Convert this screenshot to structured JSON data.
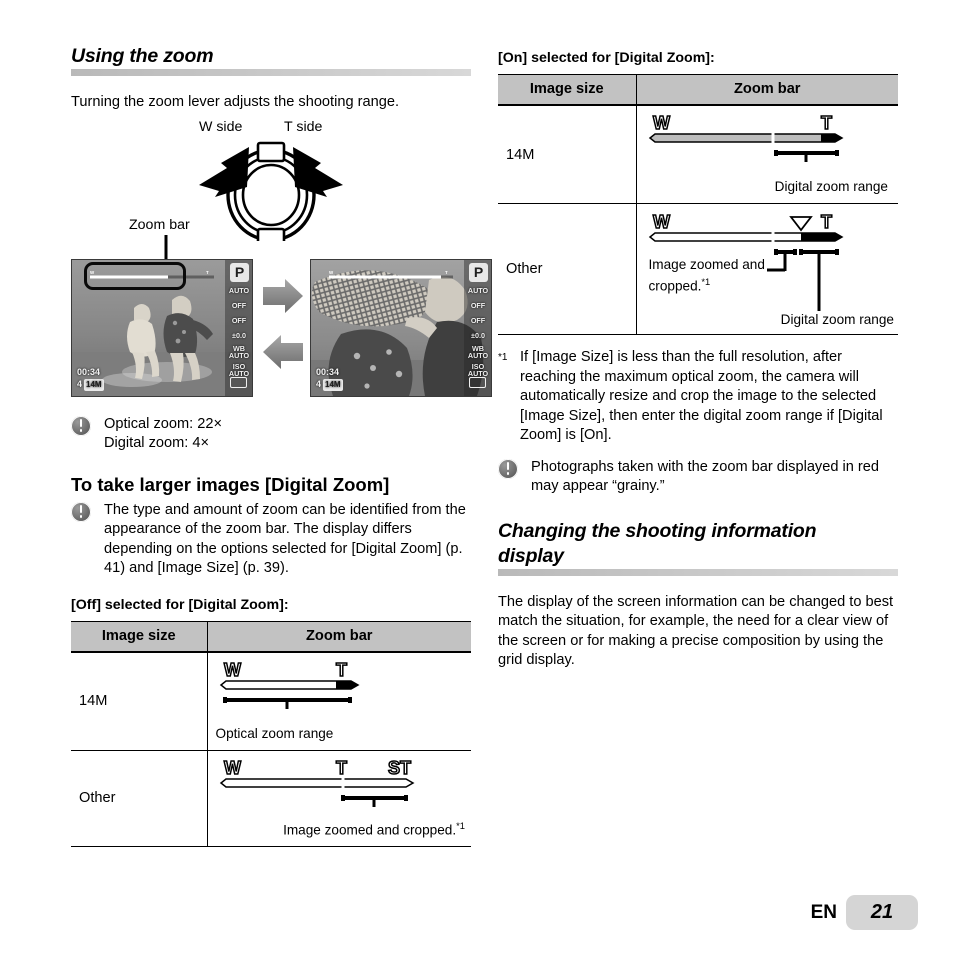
{
  "document": {
    "language_code": "EN",
    "page_number": "21"
  },
  "left_column": {
    "section_title": "Using the zoom",
    "intro": "Turning the zoom lever adjusts the shooting range.",
    "lever": {
      "w_label": "W side",
      "t_label": "T side"
    },
    "screens": {
      "callout": "Zoom bar",
      "osd": {
        "mode": "P",
        "flash": "AUTO",
        "macro": "OFF",
        "timer": "OFF",
        "exposure": "±0.0",
        "wb_label": "WB",
        "wb_value": "AUTO",
        "iso_label": "ISO",
        "iso_value": "AUTO",
        "record_time": "00:34",
        "shots_remaining": "4",
        "image_size": "14M",
        "bar_w": "W",
        "bar_t": "T"
      }
    },
    "zoom_note": {
      "optical": "Optical zoom: 22×",
      "digital": "Digital zoom: 4×"
    },
    "sub_heading": "To take larger images [Digital Zoom]",
    "sub_note": "The type and amount of zoom can be identified from the appearance of the zoom bar. The display differs depending on the options selected for [Digital Zoom] (p. 41) and [Image Size] (p. 39).",
    "table_caption": "[Off] selected for [Digital Zoom]:",
    "table": {
      "headers": [
        "Image size",
        "Zoom bar"
      ],
      "rows": [
        {
          "size": "14M",
          "markers": {
            "w": "W",
            "t": "T"
          },
          "caption": "Optical zoom range",
          "caption_sup": ""
        },
        {
          "size": "Other",
          "markers": {
            "w": "W",
            "t": "T",
            "st": "ST"
          },
          "caption": "Image zoomed and cropped.",
          "caption_sup": "*1"
        }
      ]
    }
  },
  "right_column": {
    "table_caption": "[On] selected for [Digital Zoom]:",
    "table": {
      "headers": [
        "Image size",
        "Zoom bar"
      ],
      "rows": [
        {
          "size": "14M",
          "markers": {
            "w": "W",
            "t": "T"
          },
          "caption": "Digital zoom range"
        },
        {
          "size": "Other",
          "markers": {
            "w": "W",
            "t": "T"
          },
          "caption_a": "Image zoomed and",
          "caption_a2": "cropped.",
          "caption_a_sup": "*1",
          "caption_b": "Digital zoom range"
        }
      ]
    },
    "footnote": {
      "mark": "*1",
      "text": "If [Image Size] is less than the full resolution, after reaching the maximum optical zoom, the camera will automatically resize and crop the image to the selected [Image Size], then enter the digital zoom range if [Digital Zoom] is [On]."
    },
    "grainy_note": "Photographs taken with the zoom bar displayed in red may appear “grainy.”",
    "section_title_line1": "Changing the shooting information",
    "section_title_line2": "display",
    "body": "The display of the screen information can be changed to best match the situation, for example, the need for a clear view of the screen or for making a precise composition by using the grid display."
  },
  "colors": {
    "heading_rule": "#c8c8c8",
    "table_header_bg": "#c2c2c2",
    "page_badge_bg": "#d5d5d5",
    "lcd_bg": "#8a8a8a"
  }
}
